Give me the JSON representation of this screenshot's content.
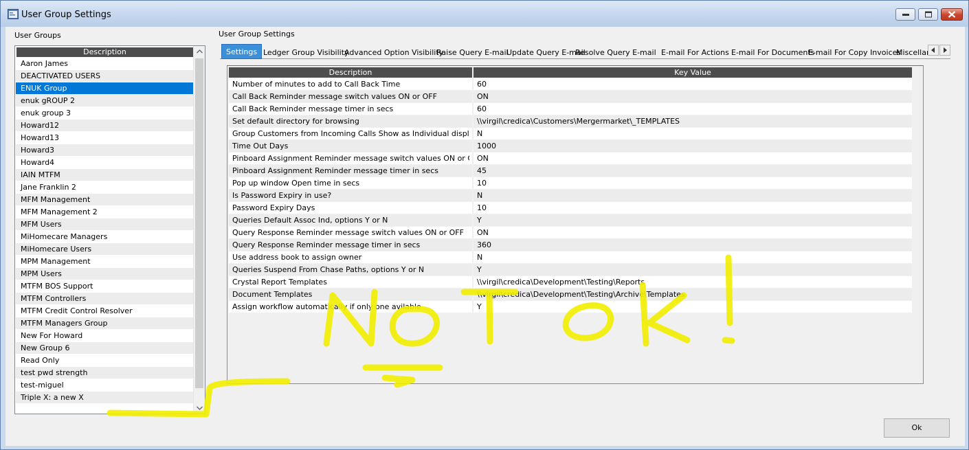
{
  "window": {
    "title": "User Group Settings"
  },
  "left_panel": {
    "label": "User Groups",
    "column_header": "Description",
    "selected_index": 2,
    "items": [
      "Aaron James",
      "DEACTIVATED USERS",
      "ENUK Group",
      "enuk gROUP 2",
      "enuk group 3",
      "Howard12",
      "Howard13",
      "Howard3",
      "Howard4",
      "IAIN MTFM",
      "Jane Franklin 2",
      "MFM Management",
      "MFM Management 2",
      "MFM Users",
      "MiHomecare Managers",
      "MiHomecare Users",
      "MPM Management",
      "MPM Users",
      "MTFM BOS Support",
      "MTFM Controllers",
      "MTFM Credit Control Resolver",
      "MTFM Managers Group",
      "New For Howard",
      "New Group 6",
      "Read Only",
      "test pwd strength",
      "test-miguel",
      "Triple X: a new X"
    ]
  },
  "right_panel": {
    "label": "User Group Settings",
    "tabs": [
      "Settings",
      "Ledger Group Visibility",
      "Advanced Option Visibility",
      "Raise Query E-mail",
      "Update Query E-mail",
      "Resolve Query E-mail",
      "E-mail For Actions",
      "E-mail For Documents",
      "E-mail For Copy Invoices",
      "Miscellane"
    ],
    "active_tab": 0,
    "grid": {
      "headers": [
        "Description",
        "Key Value"
      ],
      "rows": [
        [
          "Number of minutes to add to Call Back Time",
          "60"
        ],
        [
          "Call Back Reminder message switch values ON or OFF",
          "ON"
        ],
        [
          "Call Back Reminder message timer in secs",
          "60"
        ],
        [
          "Set default directory for browsing",
          "\\\\virgil\\credica\\Customers\\Mergermarket\\_TEMPLATES"
        ],
        [
          "Group Customers from Incoming Calls Show as Individual display",
          "N"
        ],
        [
          "Time Out Days",
          "1000"
        ],
        [
          "Pinboard Assignment Reminder message switch values ON or OFF",
          "ON"
        ],
        [
          "Pinboard Assignment Reminder message timer in secs",
          "45"
        ],
        [
          "Pop up window Open time in secs",
          "10"
        ],
        [
          "Is Password Expiry in use?",
          "N"
        ],
        [
          "Password Expiry Days",
          "10"
        ],
        [
          "Queries Default Assoc Ind, options Y or N",
          "Y"
        ],
        [
          "Query Response Reminder message switch values ON or OFF",
          "ON"
        ],
        [
          "Query Response Reminder message timer in secs",
          "360"
        ],
        [
          "Use address book to assign owner",
          "N"
        ],
        [
          "Queries Suspend From Chase Paths, options Y or N",
          "Y"
        ],
        [
          "Crystal Report Templates",
          "\\\\virgil\\credica\\Development\\Testing\\Reports"
        ],
        [
          "Document Templates",
          "\\\\virgil\\credica\\Development\\Testing\\Archive\\Templates"
        ],
        [
          "Assign workflow automatically if only one avilable",
          "Y"
        ]
      ]
    }
  },
  "footer": {
    "ok_label": "Ok"
  },
  "colors": {
    "selection": "#0078d7",
    "header_bg": "#4d4d4d",
    "active_tab": "#3c8fd9",
    "annotation": "#f2ee00"
  },
  "icons": {
    "app": "app-window-icon",
    "minimize": "minimize-icon",
    "maximize": "maximize-icon",
    "close": "close-icon"
  }
}
